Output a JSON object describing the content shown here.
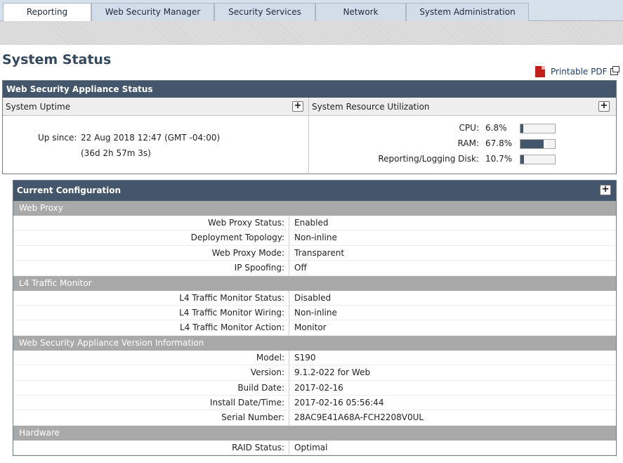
{
  "tabs": [
    {
      "label": "Reporting",
      "active": true
    },
    {
      "label": "Web Security Manager",
      "active": false
    },
    {
      "label": "Security Services",
      "active": false
    },
    {
      "label": "Network",
      "active": false
    },
    {
      "label": "System Administration",
      "active": false
    }
  ],
  "page": {
    "title": "System Status",
    "pdf_label": "Printable PDF"
  },
  "status": {
    "header": "Web Security Appliance Status",
    "uptime_head": "System Uptime",
    "resource_head": "System Resource Utilization",
    "up_since_label": "Up since:",
    "up_since_value": "22 Aug 2018 12:47 (GMT -04:00)",
    "up_duration": "(36d 2h 57m 3s)",
    "resources": [
      {
        "label": "CPU:",
        "value": "6.8%",
        "fraction": 0.068
      },
      {
        "label": "RAM:",
        "value": "67.8%",
        "fraction": 0.678
      },
      {
        "label": "Reporting/Logging Disk:",
        "value": "10.7%",
        "fraction": 0.107
      }
    ]
  },
  "config": {
    "header": "Current Configuration",
    "sections": [
      {
        "title": "Web Proxy",
        "rows": [
          {
            "label": "Web Proxy Status:",
            "value": "Enabled"
          },
          {
            "label": "Deployment Topology:",
            "value": "Non-inline"
          },
          {
            "label": "Web Proxy Mode:",
            "value": "Transparent"
          },
          {
            "label": "IP Spoofing:",
            "value": "Off"
          }
        ]
      },
      {
        "title": "L4 Traffic Monitor",
        "rows": [
          {
            "label": "L4 Traffic Monitor Status:",
            "value": "Disabled"
          },
          {
            "label": "L4 Traffic Monitor Wiring:",
            "value": "Non-inline"
          },
          {
            "label": "L4 Traffic Monitor Action:",
            "value": "Monitor"
          }
        ]
      },
      {
        "title": "Web Security Appliance Version Information",
        "rows": [
          {
            "label": "Model:",
            "value": "S190"
          },
          {
            "label": "Version:",
            "value": "9.1.2-022 for Web"
          },
          {
            "label": "Build Date:",
            "value": "2017-02-16"
          },
          {
            "label": "Install Date/Time:",
            "value": "2017-02-16 05:56:44"
          },
          {
            "label": "Serial Number:",
            "value": "28AC9E41A68A-FCH2208V0UL"
          }
        ]
      },
      {
        "title": "Hardware",
        "rows": [
          {
            "label": "RAID Status:",
            "value": "Optimal"
          }
        ]
      }
    ]
  },
  "icons": {
    "plus": "+",
    "pdf": "pdf-icon",
    "popout": "popout-icon"
  }
}
